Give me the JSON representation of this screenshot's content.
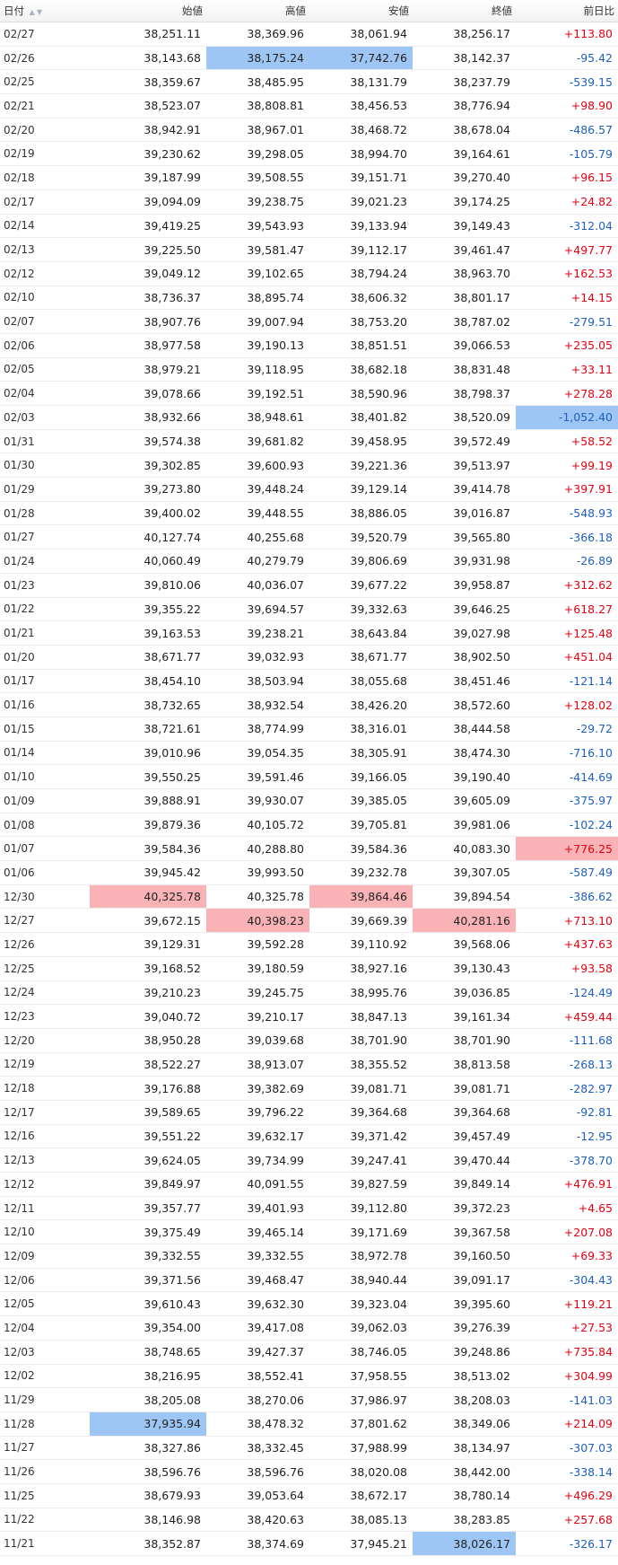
{
  "table": {
    "headers": {
      "date": "日付",
      "open": "始値",
      "high": "高値",
      "low": "安値",
      "close": "終値",
      "change": "前日比"
    },
    "sort_icons": [
      "sort-asc-icon",
      "sort-desc-icon"
    ],
    "highlight_colors": {
      "blue": "#9ec6f5",
      "red": "#f9b3b6"
    },
    "change_colors": {
      "positive": "#e60012",
      "negative": "#1f5fbf"
    },
    "rows": [
      {
        "date": "02/27",
        "open": "38,251.11",
        "high": "38,369.96",
        "low": "38,061.94",
        "close": "38,256.17",
        "change": "+113.80"
      },
      {
        "date": "02/26",
        "open": "38,143.68",
        "high": "38,175.24",
        "low": "37,742.76",
        "close": "38,142.37",
        "change": "-95.42",
        "hl": {
          "high": "blue",
          "low": "blue"
        }
      },
      {
        "date": "02/25",
        "open": "38,359.67",
        "high": "38,485.95",
        "low": "38,131.79",
        "close": "38,237.79",
        "change": "-539.15"
      },
      {
        "date": "02/21",
        "open": "38,523.07",
        "high": "38,808.81",
        "low": "38,456.53",
        "close": "38,776.94",
        "change": "+98.90"
      },
      {
        "date": "02/20",
        "open": "38,942.91",
        "high": "38,967.01",
        "low": "38,468.72",
        "close": "38,678.04",
        "change": "-486.57"
      },
      {
        "date": "02/19",
        "open": "39,230.62",
        "high": "39,298.05",
        "low": "38,994.70",
        "close": "39,164.61",
        "change": "-105.79"
      },
      {
        "date": "02/18",
        "open": "39,187.99",
        "high": "39,508.55",
        "low": "39,151.71",
        "close": "39,270.40",
        "change": "+96.15"
      },
      {
        "date": "02/17",
        "open": "39,094.09",
        "high": "39,238.75",
        "low": "39,021.23",
        "close": "39,174.25",
        "change": "+24.82"
      },
      {
        "date": "02/14",
        "open": "39,419.25",
        "high": "39,543.93",
        "low": "39,133.94",
        "close": "39,149.43",
        "change": "-312.04"
      },
      {
        "date": "02/13",
        "open": "39,225.50",
        "high": "39,581.47",
        "low": "39,112.17",
        "close": "39,461.47",
        "change": "+497.77"
      },
      {
        "date": "02/12",
        "open": "39,049.12",
        "high": "39,102.65",
        "low": "38,794.24",
        "close": "38,963.70",
        "change": "+162.53"
      },
      {
        "date": "02/10",
        "open": "38,736.37",
        "high": "38,895.74",
        "low": "38,606.32",
        "close": "38,801.17",
        "change": "+14.15"
      },
      {
        "date": "02/07",
        "open": "38,907.76",
        "high": "39,007.94",
        "low": "38,753.20",
        "close": "38,787.02",
        "change": "-279.51"
      },
      {
        "date": "02/06",
        "open": "38,977.58",
        "high": "39,190.13",
        "low": "38,851.51",
        "close": "39,066.53",
        "change": "+235.05"
      },
      {
        "date": "02/05",
        "open": "38,979.21",
        "high": "39,118.95",
        "low": "38,682.18",
        "close": "38,831.48",
        "change": "+33.11"
      },
      {
        "date": "02/04",
        "open": "39,078.66",
        "high": "39,192.51",
        "low": "38,590.96",
        "close": "38,798.37",
        "change": "+278.28"
      },
      {
        "date": "02/03",
        "open": "38,932.66",
        "high": "38,948.61",
        "low": "38,401.82",
        "close": "38,520.09",
        "change": "-1,052.40",
        "hl": {
          "change": "blue"
        }
      },
      {
        "date": "01/31",
        "open": "39,574.38",
        "high": "39,681.82",
        "low": "39,458.95",
        "close": "39,572.49",
        "change": "+58.52"
      },
      {
        "date": "01/30",
        "open": "39,302.85",
        "high": "39,600.93",
        "low": "39,221.36",
        "close": "39,513.97",
        "change": "+99.19"
      },
      {
        "date": "01/29",
        "open": "39,273.80",
        "high": "39,448.24",
        "low": "39,129.14",
        "close": "39,414.78",
        "change": "+397.91"
      },
      {
        "date": "01/28",
        "open": "39,400.02",
        "high": "39,448.55",
        "low": "38,886.05",
        "close": "39,016.87",
        "change": "-548.93"
      },
      {
        "date": "01/27",
        "open": "40,127.74",
        "high": "40,255.68",
        "low": "39,520.79",
        "close": "39,565.80",
        "change": "-366.18"
      },
      {
        "date": "01/24",
        "open": "40,060.49",
        "high": "40,279.79",
        "low": "39,806.69",
        "close": "39,931.98",
        "change": "-26.89"
      },
      {
        "date": "01/23",
        "open": "39,810.06",
        "high": "40,036.07",
        "low": "39,677.22",
        "close": "39,958.87",
        "change": "+312.62"
      },
      {
        "date": "01/22",
        "open": "39,355.22",
        "high": "39,694.57",
        "low": "39,332.63",
        "close": "39,646.25",
        "change": "+618.27"
      },
      {
        "date": "01/21",
        "open": "39,163.53",
        "high": "39,238.21",
        "low": "38,643.84",
        "close": "39,027.98",
        "change": "+125.48"
      },
      {
        "date": "01/20",
        "open": "38,671.77",
        "high": "39,032.93",
        "low": "38,671.77",
        "close": "38,902.50",
        "change": "+451.04"
      },
      {
        "date": "01/17",
        "open": "38,454.10",
        "high": "38,503.94",
        "low": "38,055.68",
        "close": "38,451.46",
        "change": "-121.14"
      },
      {
        "date": "01/16",
        "open": "38,732.65",
        "high": "38,932.54",
        "low": "38,426.20",
        "close": "38,572.60",
        "change": "+128.02"
      },
      {
        "date": "01/15",
        "open": "38,721.61",
        "high": "38,774.99",
        "low": "38,316.01",
        "close": "38,444.58",
        "change": "-29.72"
      },
      {
        "date": "01/14",
        "open": "39,010.96",
        "high": "39,054.35",
        "low": "38,305.91",
        "close": "38,474.30",
        "change": "-716.10"
      },
      {
        "date": "01/10",
        "open": "39,550.25",
        "high": "39,591.46",
        "low": "39,166.05",
        "close": "39,190.40",
        "change": "-414.69"
      },
      {
        "date": "01/09",
        "open": "39,888.91",
        "high": "39,930.07",
        "low": "39,385.05",
        "close": "39,605.09",
        "change": "-375.97"
      },
      {
        "date": "01/08",
        "open": "39,879.36",
        "high": "40,105.72",
        "low": "39,705.81",
        "close": "39,981.06",
        "change": "-102.24"
      },
      {
        "date": "01/07",
        "open": "39,584.36",
        "high": "40,288.80",
        "low": "39,584.36",
        "close": "40,083.30",
        "change": "+776.25",
        "hl": {
          "change": "red"
        }
      },
      {
        "date": "01/06",
        "open": "39,945.42",
        "high": "39,993.50",
        "low": "39,232.78",
        "close": "39,307.05",
        "change": "-587.49"
      },
      {
        "date": "12/30",
        "open": "40,325.78",
        "high": "40,325.78",
        "low": "39,864.46",
        "close": "39,894.54",
        "change": "-386.62",
        "hl": {
          "open": "red",
          "low": "red"
        }
      },
      {
        "date": "12/27",
        "open": "39,672.15",
        "high": "40,398.23",
        "low": "39,669.39",
        "close": "40,281.16",
        "change": "+713.10",
        "hl": {
          "high": "red",
          "close": "red"
        }
      },
      {
        "date": "12/26",
        "open": "39,129.31",
        "high": "39,592.28",
        "low": "39,110.92",
        "close": "39,568.06",
        "change": "+437.63"
      },
      {
        "date": "12/25",
        "open": "39,168.52",
        "high": "39,180.59",
        "low": "38,927.16",
        "close": "39,130.43",
        "change": "+93.58"
      },
      {
        "date": "12/24",
        "open": "39,210.23",
        "high": "39,245.75",
        "low": "38,995.76",
        "close": "39,036.85",
        "change": "-124.49"
      },
      {
        "date": "12/23",
        "open": "39,040.72",
        "high": "39,210.17",
        "low": "38,847.13",
        "close": "39,161.34",
        "change": "+459.44"
      },
      {
        "date": "12/20",
        "open": "38,950.28",
        "high": "39,039.68",
        "low": "38,701.90",
        "close": "38,701.90",
        "change": "-111.68"
      },
      {
        "date": "12/19",
        "open": "38,522.27",
        "high": "38,913.07",
        "low": "38,355.52",
        "close": "38,813.58",
        "change": "-268.13"
      },
      {
        "date": "12/18",
        "open": "39,176.88",
        "high": "39,382.69",
        "low": "39,081.71",
        "close": "39,081.71",
        "change": "-282.97"
      },
      {
        "date": "12/17",
        "open": "39,589.65",
        "high": "39,796.22",
        "low": "39,364.68",
        "close": "39,364.68",
        "change": "-92.81"
      },
      {
        "date": "12/16",
        "open": "39,551.22",
        "high": "39,632.17",
        "low": "39,371.42",
        "close": "39,457.49",
        "change": "-12.95"
      },
      {
        "date": "12/13",
        "open": "39,624.05",
        "high": "39,734.99",
        "low": "39,247.41",
        "close": "39,470.44",
        "change": "-378.70"
      },
      {
        "date": "12/12",
        "open": "39,849.97",
        "high": "40,091.55",
        "low": "39,827.59",
        "close": "39,849.14",
        "change": "+476.91"
      },
      {
        "date": "12/11",
        "open": "39,357.77",
        "high": "39,401.93",
        "low": "39,112.80",
        "close": "39,372.23",
        "change": "+4.65"
      },
      {
        "date": "12/10",
        "open": "39,375.49",
        "high": "39,465.14",
        "low": "39,171.69",
        "close": "39,367.58",
        "change": "+207.08"
      },
      {
        "date": "12/09",
        "open": "39,332.55",
        "high": "39,332.55",
        "low": "38,972.78",
        "close": "39,160.50",
        "change": "+69.33"
      },
      {
        "date": "12/06",
        "open": "39,371.56",
        "high": "39,468.47",
        "low": "38,940.44",
        "close": "39,091.17",
        "change": "-304.43"
      },
      {
        "date": "12/05",
        "open": "39,610.43",
        "high": "39,632.30",
        "low": "39,323.04",
        "close": "39,395.60",
        "change": "+119.21"
      },
      {
        "date": "12/04",
        "open": "39,354.00",
        "high": "39,417.08",
        "low": "39,062.03",
        "close": "39,276.39",
        "change": "+27.53"
      },
      {
        "date": "12/03",
        "open": "38,748.65",
        "high": "39,427.37",
        "low": "38,746.05",
        "close": "39,248.86",
        "change": "+735.84"
      },
      {
        "date": "12/02",
        "open": "38,216.95",
        "high": "38,552.41",
        "low": "37,958.55",
        "close": "38,513.02",
        "change": "+304.99"
      },
      {
        "date": "11/29",
        "open": "38,205.08",
        "high": "38,270.06",
        "low": "37,986.97",
        "close": "38,208.03",
        "change": "-141.03"
      },
      {
        "date": "11/28",
        "open": "37,935.94",
        "high": "38,478.32",
        "low": "37,801.62",
        "close": "38,349.06",
        "change": "+214.09",
        "hl": {
          "open": "blue"
        }
      },
      {
        "date": "11/27",
        "open": "38,327.86",
        "high": "38,332.45",
        "low": "37,988.99",
        "close": "38,134.97",
        "change": "-307.03"
      },
      {
        "date": "11/26",
        "open": "38,596.76",
        "high": "38,596.76",
        "low": "38,020.08",
        "close": "38,442.00",
        "change": "-338.14"
      },
      {
        "date": "11/25",
        "open": "38,679.93",
        "high": "39,053.64",
        "low": "38,672.17",
        "close": "38,780.14",
        "change": "+496.29"
      },
      {
        "date": "11/22",
        "open": "38,146.98",
        "high": "38,420.63",
        "low": "38,085.13",
        "close": "38,283.85",
        "change": "+257.68"
      },
      {
        "date": "11/21",
        "open": "38,352.87",
        "high": "38,374.69",
        "low": "37,945.21",
        "close": "38,026.17",
        "change": "-326.17",
        "hl": {
          "close": "blue"
        }
      }
    ]
  }
}
